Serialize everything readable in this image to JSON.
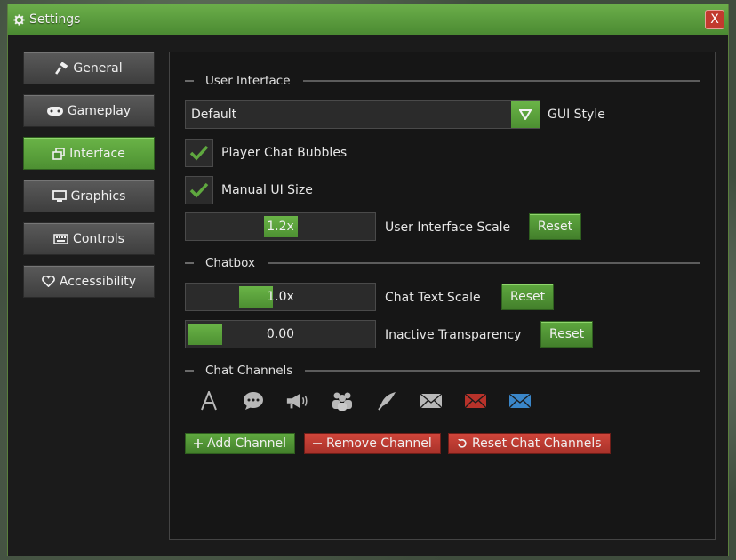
{
  "window": {
    "title": "Settings",
    "close_label": "X"
  },
  "nav": {
    "items": [
      {
        "label": "General",
        "icon": "hammer-icon",
        "active": false
      },
      {
        "label": "Gameplay",
        "icon": "gamepad-icon",
        "active": false
      },
      {
        "label": "Interface",
        "icon": "windows-icon",
        "active": true
      },
      {
        "label": "Graphics",
        "icon": "monitor-icon",
        "active": false
      },
      {
        "label": "Controls",
        "icon": "keyboard-icon",
        "active": false
      },
      {
        "label": "Accessibility",
        "icon": "heart-icon",
        "active": false
      }
    ]
  },
  "sections": {
    "user_interface": "User Interface",
    "chatbox": "Chatbox",
    "chat_channels": "Chat Channels"
  },
  "ui": {
    "gui_style_value": "Default",
    "gui_style_label": "GUI Style",
    "player_chat_bubbles_label": "Player Chat Bubbles",
    "player_chat_bubbles_checked": true,
    "manual_ui_size_label": "Manual UI Size",
    "manual_ui_size_checked": true,
    "ui_scale_value": "1.2x",
    "ui_scale_fraction": 0.5,
    "ui_scale_label": "User Interface Scale",
    "reset_label": "Reset"
  },
  "chatbox": {
    "text_scale_value": "1.0x",
    "text_scale_fraction": 0.34,
    "text_scale_label": "Chat Text Scale",
    "transparency_value": "0.00",
    "transparency_fraction": 0.0,
    "transparency_label": "Inactive Transparency",
    "reset_label": "Reset"
  },
  "channels": {
    "icons": [
      "letter-a-icon",
      "speech-bubble-icon",
      "megaphone-icon",
      "group-icon",
      "feather-icon",
      "envelope-icon",
      "envelope-red-icon",
      "envelope-blue-icon"
    ],
    "add_label": "Add Channel",
    "remove_label": "Remove Channel",
    "reset_label": "Reset Chat Channels"
  },
  "colors": {
    "accent_green": "#5fa83f",
    "danger_red": "#c23a2e",
    "blue": "#3a86c9"
  }
}
